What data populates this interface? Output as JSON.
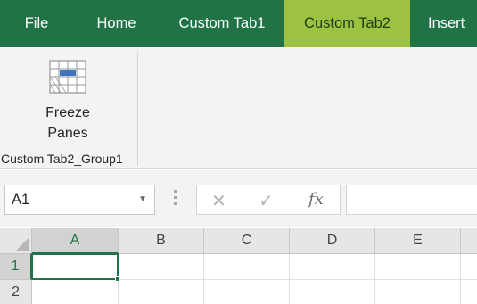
{
  "ribbon_tabs": [
    {
      "label": "File",
      "active": false
    },
    {
      "label": "Home",
      "active": false
    },
    {
      "label": "Custom Tab1",
      "active": false
    },
    {
      "label": "Custom Tab2",
      "active": true
    },
    {
      "label": "Insert",
      "active": false
    }
  ],
  "ribbon": {
    "freeze_panes": {
      "line1": "Freeze",
      "line2": "Panes",
      "icon": "freeze-panes-icon"
    },
    "group_label": "Custom Tab2_Group1"
  },
  "formula_bar": {
    "name_box_value": "A1",
    "cancel_symbol": "✕",
    "enter_symbol": "✓",
    "fx_symbol": "fx",
    "formula_value": ""
  },
  "grid": {
    "columns": [
      "A",
      "B",
      "C",
      "D",
      "E"
    ],
    "rows": [
      "1",
      "2"
    ],
    "selected_cell": "A1"
  },
  "colors": {
    "ribbon_green": "#217346",
    "active_tab": "#9dc140"
  }
}
